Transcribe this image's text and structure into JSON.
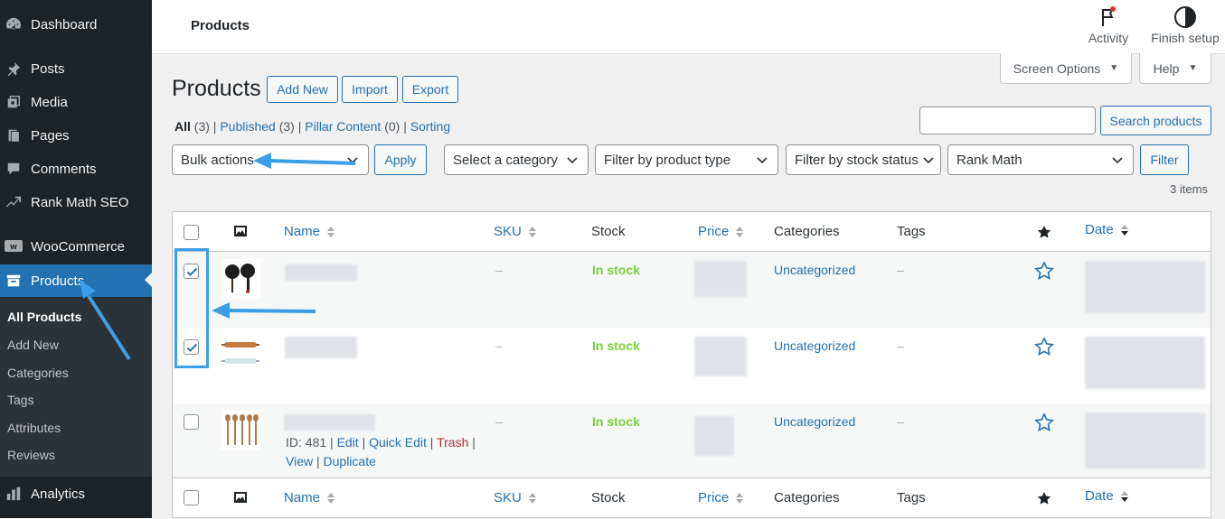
{
  "sidebar": {
    "items": [
      {
        "label": "Dashboard",
        "icon": "dashboard-icon"
      },
      {
        "label": "Posts",
        "icon": "pin-icon"
      },
      {
        "label": "Media",
        "icon": "media-icon"
      },
      {
        "label": "Pages",
        "icon": "pages-icon"
      },
      {
        "label": "Comments",
        "icon": "comments-icon"
      },
      {
        "label": "Rank Math SEO",
        "icon": "rank-math-icon"
      },
      {
        "label": "WooCommerce",
        "icon": "woo-icon"
      },
      {
        "label": "Products",
        "icon": "archive-icon"
      },
      {
        "label": "Analytics",
        "icon": "bar-chart-icon"
      }
    ],
    "submenu": [
      "All Products",
      "Add New",
      "Categories",
      "Tags",
      "Attributes",
      "Reviews"
    ]
  },
  "topbar": {
    "title": "Products",
    "activity_label": "Activity",
    "finish_setup_label": "Finish setup"
  },
  "screen_options_label": "Screen Options",
  "help_label": "Help",
  "page_title": "Products",
  "header_buttons": {
    "add_new": "Add New",
    "import": "Import",
    "export": "Export"
  },
  "views": [
    {
      "label": "All",
      "count": "(3)"
    },
    {
      "label": "Published",
      "count": "(3)"
    },
    {
      "label": "Pillar Content",
      "count": "(0)"
    },
    {
      "label": "Sorting",
      "count": ""
    }
  ],
  "search": {
    "value": "",
    "button": "Search products"
  },
  "filters": {
    "bulk_actions": "Bulk actions",
    "apply": "Apply",
    "category": "Select a category",
    "product_type": "Filter by product type",
    "stock_status": "Filter by stock status",
    "rank_math": "Rank Math",
    "filter_button": "Filter"
  },
  "items_count": "3 items",
  "table": {
    "columns": {
      "name": "Name",
      "sku": "SKU",
      "stock": "Stock",
      "price": "Price",
      "categories": "Categories",
      "tags": "Tags",
      "date": "Date"
    },
    "rows": [
      {
        "checked": true,
        "sku": "–",
        "stock": "In stock",
        "category": "Uncategorized",
        "tags": "–"
      },
      {
        "checked": true,
        "sku": "–",
        "stock": "In stock",
        "category": "Uncategorized",
        "tags": "–"
      },
      {
        "checked": false,
        "sku": "–",
        "stock": "In stock",
        "category": "Uncategorized",
        "tags": "–",
        "row_actions": {
          "id": "ID: 481",
          "edit": "Edit",
          "quick_edit": "Quick Edit",
          "trash": "Trash",
          "view": "View",
          "duplicate": "Duplicate"
        }
      }
    ]
  },
  "colors": {
    "accent": "#2271b1",
    "sidebar": "#1d2327",
    "in_stock": "#7ad03a",
    "annotation": "#3b9ee8"
  }
}
